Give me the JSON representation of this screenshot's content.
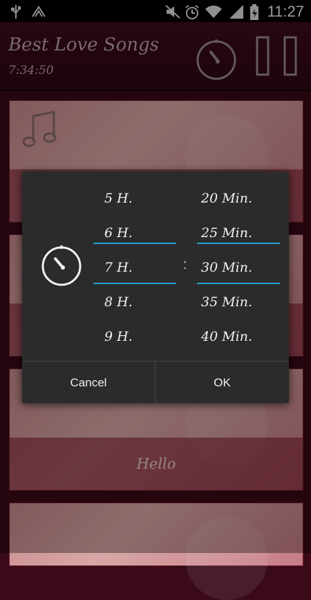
{
  "status_bar": {
    "time": "11:27",
    "icons": [
      "usb-icon",
      "signal-waves-icon",
      "mute-icon",
      "alarm-icon",
      "wifi-icon",
      "cell-signal-icon",
      "battery-icon"
    ]
  },
  "header": {
    "title": "Best Love Songs",
    "time": "7:34:50",
    "icons": [
      "timer-icon",
      "pause-icon"
    ]
  },
  "list": {
    "items": [
      {
        "caption": ""
      },
      {
        "caption": ""
      },
      {
        "caption": "Hello"
      },
      {
        "caption": ""
      }
    ]
  },
  "dialog": {
    "hours": [
      "5 H.",
      "6 H.",
      "7 H.",
      "8 H.",
      "9 H."
    ],
    "selected_hour": "7 H.",
    "minutes": [
      "20 Min.",
      "25 Min.",
      "30 Min.",
      "35 Min.",
      "40 Min."
    ],
    "selected_minute": "30 Min.",
    "separator": ":",
    "cancel_label": "Cancel",
    "ok_label": "OK"
  },
  "colors": {
    "accent": "#2aa0d8",
    "dialog_bg": "#2b2b2b",
    "header_bg": "#3d0b1d"
  }
}
